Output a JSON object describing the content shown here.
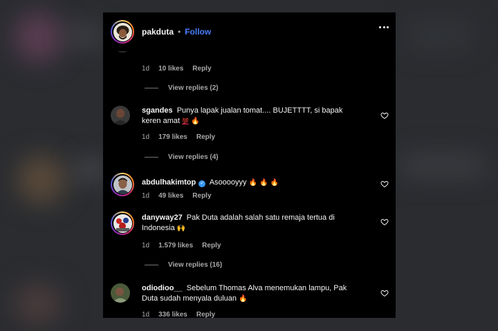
{
  "post": {
    "username": "pakduta",
    "separator": "•",
    "follow_label": "Follow"
  },
  "colors": {
    "accent_follow": "#4a7fff",
    "muted": "#a8a8a8",
    "verified": "#3897f0",
    "panel_bg": "#000000"
  },
  "top_meta": {
    "time": "1d",
    "likes": "10 likes",
    "reply": "Reply"
  },
  "top_replies": "View replies (2)",
  "comments": [
    {
      "username": "sgandes",
      "text": "Punya lapak jualan tomat.... BUJETTTT, si bapak keren amat",
      "emojis": [
        "hundred-points-emoji",
        "fire-emoji"
      ],
      "emoji_glyphs": [
        "💯",
        "🔥"
      ],
      "verified": false,
      "time": "1d",
      "likes": "179 likes",
      "reply": "Reply",
      "view_replies": "View replies (4)"
    },
    {
      "username": "abdulhakimtop",
      "text": "Asooooyyy",
      "emojis": [
        "fire-emoji",
        "fire-emoji",
        "fire-emoji"
      ],
      "emoji_glyphs": [
        "🔥",
        "🔥",
        "🔥"
      ],
      "verified": true,
      "time": "1d",
      "likes": "49 likes",
      "reply": "Reply"
    },
    {
      "username": "danyway27",
      "text": "Pak Duta adalah salah satu remaja tertua di Indonesia",
      "emojis": [
        "raising-hands-emoji"
      ],
      "emoji_glyphs": [
        "🙌"
      ],
      "verified": false,
      "time": "1d",
      "likes": "1.579 likes",
      "reply": "Reply",
      "view_replies": "View replies (16)"
    },
    {
      "username": "odiodioo__",
      "text": "Sebelum Thomas Alva menemukan lampu, Pak Duta sudah menyala duluan",
      "emojis": [
        "fire-emoji"
      ],
      "emoji_glyphs": [
        "🔥"
      ],
      "verified": false,
      "time": "1d",
      "likes": "336 likes",
      "reply": "Reply"
    }
  ]
}
